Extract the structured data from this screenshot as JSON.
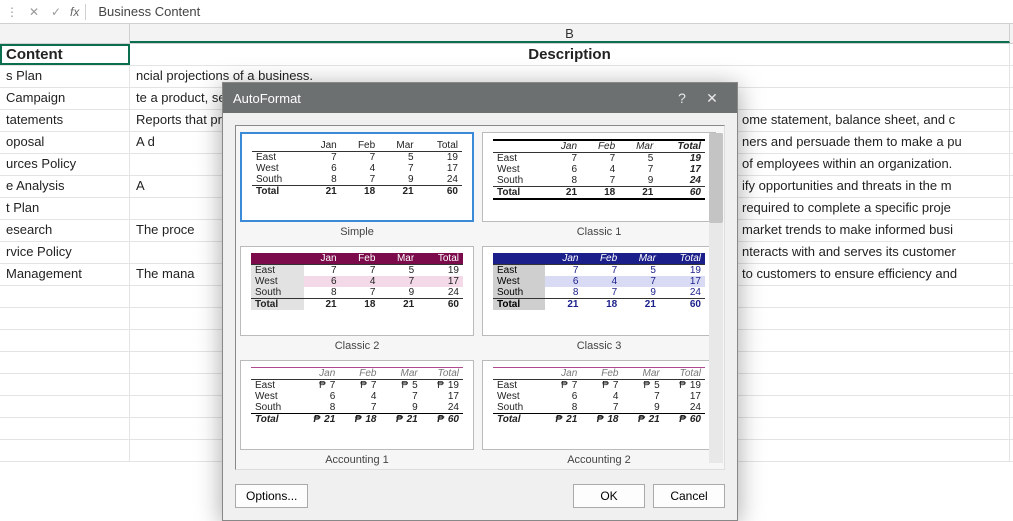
{
  "formulaBar": {
    "cancelGlyph": "✕",
    "acceptGlyph": "✓",
    "fxLabel": "fx",
    "value": "Business Content"
  },
  "columns": {
    "a": "",
    "b": "B"
  },
  "headerRow": {
    "a": "Content",
    "b": "Description"
  },
  "rows": [
    {
      "a": "s Plan",
      "b": "ncial projections of a business."
    },
    {
      "a": "Campaign",
      "b": "te a product, service, or brand."
    },
    {
      "a": "tatements",
      "b": "Reports that pr",
      "b2": "ome statement, balance sheet, and c"
    },
    {
      "a": "oposal",
      "b": "A d",
      "b2": "ners and persuade them to make a pu"
    },
    {
      "a": "urces Policy",
      "b": "",
      "b2": "of employees within an organization."
    },
    {
      "a": "e Analysis",
      "b": "A",
      "b2": "ify opportunities and threats in the m"
    },
    {
      "a": "t Plan",
      "b": "",
      "b2": "required to complete a specific proje"
    },
    {
      "a": "esearch",
      "b": "The proce",
      "b2": "market trends to make informed busi"
    },
    {
      "a": "rvice Policy",
      "b": "",
      "b2": "nteracts with and serves its customer"
    },
    {
      "a": "Management",
      "b": "The mana",
      "b2": "to customers to ensure efficiency and"
    }
  ],
  "dialog": {
    "title": "AutoFormat",
    "helpGlyph": "?",
    "closeGlyph": "✕",
    "optionsLabel": "Options...",
    "okLabel": "OK",
    "cancelLabel": "Cancel",
    "previews": [
      {
        "label": "Simple",
        "style": "simple",
        "selected": true
      },
      {
        "label": "Classic 1",
        "style": "classic1",
        "selected": false
      },
      {
        "label": "Classic 2",
        "style": "classic2",
        "selected": false
      },
      {
        "label": "Classic 3",
        "style": "classic3",
        "selected": false
      },
      {
        "label": "Accounting 1",
        "style": "accounting",
        "selected": false
      },
      {
        "label": "Accounting 2",
        "style": "accounting",
        "selected": false
      }
    ]
  },
  "chart_data": {
    "type": "table",
    "row_headers": [
      "East",
      "West",
      "South",
      "Total"
    ],
    "columns": [
      "Jan",
      "Feb",
      "Mar",
      "Total"
    ],
    "values": [
      [
        7,
        7,
        5,
        19
      ],
      [
        6,
        4,
        7,
        17
      ],
      [
        8,
        7,
        9,
        24
      ],
      [
        21,
        18,
        21,
        60
      ]
    ],
    "currency_symbol": "₱"
  }
}
